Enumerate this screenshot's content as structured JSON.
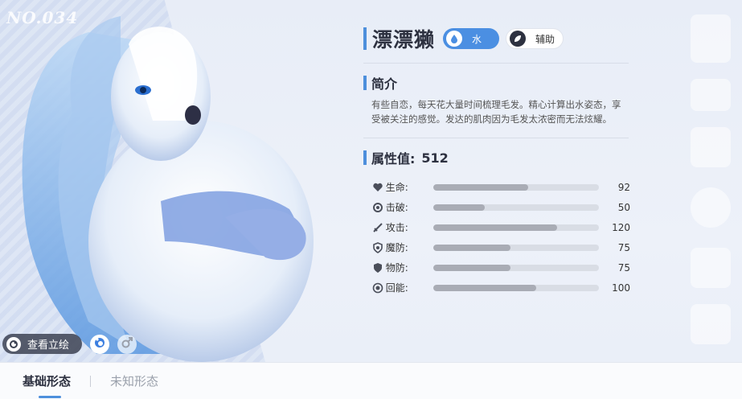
{
  "number_label": "NO.034",
  "name": "漂漂獭",
  "element": {
    "label": "水",
    "icon": "water-drop-icon",
    "color": "#4b8fe2"
  },
  "role": {
    "label": "辅助",
    "icon": "leaf-icon"
  },
  "intro": {
    "title": "简介",
    "text": "有些自恋，每天花大量时间梳理毛发。精心计算出水姿态，享受被关注的感觉。发达的肌肉因为毛发太浓密而无法炫耀。"
  },
  "stats": {
    "title": "属性值:",
    "total": "512",
    "items": [
      {
        "icon": "heart-icon",
        "label": "生命:",
        "value": 92
      },
      {
        "icon": "burst-icon",
        "label": "击破:",
        "value": 50
      },
      {
        "icon": "sword-icon",
        "label": "攻击:",
        "value": 120
      },
      {
        "icon": "magic-shield-icon",
        "label": "魔防:",
        "value": 75
      },
      {
        "icon": "shield-icon",
        "label": "物防:",
        "value": 75
      },
      {
        "icon": "energy-icon",
        "label": "回能:",
        "value": 100
      }
    ]
  },
  "controls": {
    "view_art_label": "查看立绘",
    "shiny_icon": "shiny-toggle-icon",
    "gender_icon": "male-icon"
  },
  "tabs": [
    {
      "label": "基础形态",
      "active": true
    },
    {
      "label": "未知形态",
      "active": false
    }
  ],
  "colors": {
    "accent": "#4d8fdc",
    "bar_fill": "#a9acb5",
    "bar_track": "#d9dde5"
  }
}
